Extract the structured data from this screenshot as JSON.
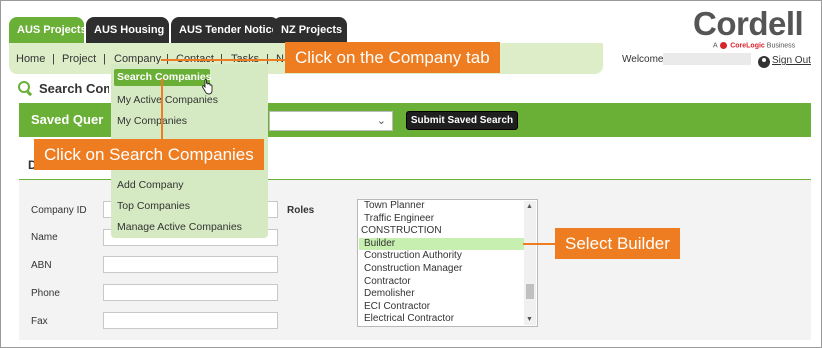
{
  "tabs": [
    "AUS Projects",
    "AUS Housing",
    "AUS Tender Notices",
    "NZ Projects"
  ],
  "logo": {
    "text": "Cordell",
    "byline_prefix": "A",
    "byline_brand": "CoreLogic",
    "byline_suffix": "Business"
  },
  "nav": {
    "items": [
      "Home",
      "Project",
      "Company",
      "Contact",
      "Tasks",
      "N"
    ],
    "separator": "|"
  },
  "header": {
    "welcome": "Welcome",
    "signout": "Sign Out"
  },
  "page": {
    "title": "Search Com",
    "saved_label": "Saved Quer",
    "submit_button": "Submit Saved Search",
    "section_letter": "D"
  },
  "form": {
    "company_id": "Company ID",
    "name": "Name",
    "abn": "ABN",
    "phone": "Phone",
    "fax": "Fax",
    "roles": "Roles"
  },
  "roles": [
    "Town Planner",
    "Traffic Engineer",
    "CONSTRUCTION",
    "Builder",
    "Construction Authority",
    "Construction Manager",
    "Contractor",
    "Demolisher",
    "ECI Contractor",
    "Electrical Contractor"
  ],
  "dropdown": [
    "Search Companies",
    "My Active Companies",
    "My Companies",
    "Add Company",
    "Top Companies",
    "Manage Active Companies"
  ],
  "callouts": {
    "company_tab": "Click on the Company tab",
    "search_companies": "Click on Search Companies",
    "builder": "Select Builder"
  },
  "colors": {
    "accent": "#6aaf36",
    "callout": "#ee7d21",
    "dark_tab": "#2e2e2e",
    "selected_role": "#c6efb0"
  },
  "icons": [
    "search-icon",
    "user-icon",
    "scroll-up-arrow",
    "scroll-down-arrow",
    "chevron-down-icon",
    "hand-cursor-icon"
  ]
}
